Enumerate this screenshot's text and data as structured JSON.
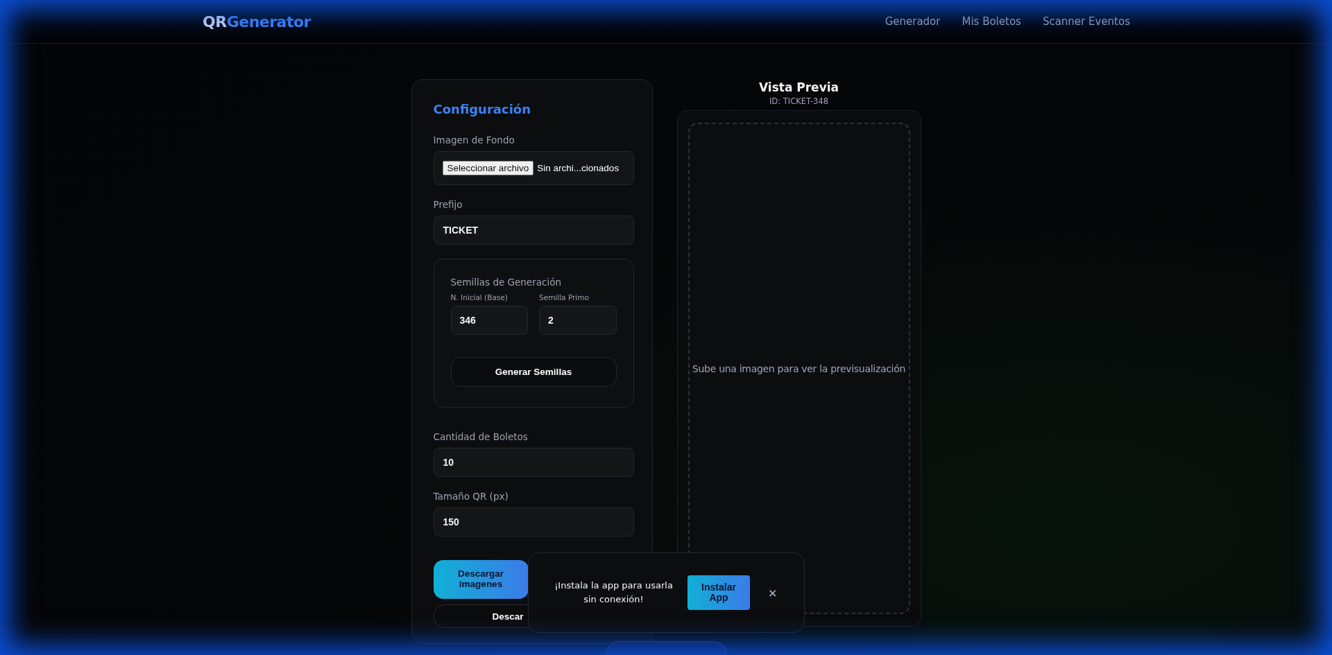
{
  "header": {
    "logo": {
      "part_1": "QR",
      "part_2": "Generator"
    },
    "nav": [
      {
        "label": "Generador"
      },
      {
        "label": "Mis Boletos"
      },
      {
        "label": "Scanner Eventos"
      }
    ]
  },
  "config": {
    "title": "Configuración",
    "background_image": {
      "label": "Imagen de Fondo",
      "button": "Seleccionar archivo",
      "status": "Sin archi...cionados"
    },
    "prefix": {
      "label": "Prefijo",
      "value": "TICKET"
    },
    "seeds": {
      "title": "Semillas de Generación",
      "fields": [
        {
          "label": "N. Inicial (Base)",
          "value": "346"
        },
        {
          "label": "Semilla Primo",
          "value": "2"
        }
      ],
      "button": "Generar Semillas"
    },
    "quantity": {
      "label": "Cantidad de Boletos",
      "value": "10"
    },
    "qr_size": {
      "label": "Tamaño QR (px)",
      "value": "150"
    },
    "buttons": [
      {
        "label": "Descargar imagenes",
        "kind": "primary"
      },
      {
        "label": "Descar",
        "kind": "outline"
      }
    ]
  },
  "preview": {
    "title": "Vista Previa",
    "id": "ID: TICKET-348",
    "empty_message": "Sube una imagen para ver la previsualización"
  },
  "toast": {
    "message": "¡Instala la app para usarla sin conexión!",
    "button": "Instalar App",
    "close": "×"
  }
}
